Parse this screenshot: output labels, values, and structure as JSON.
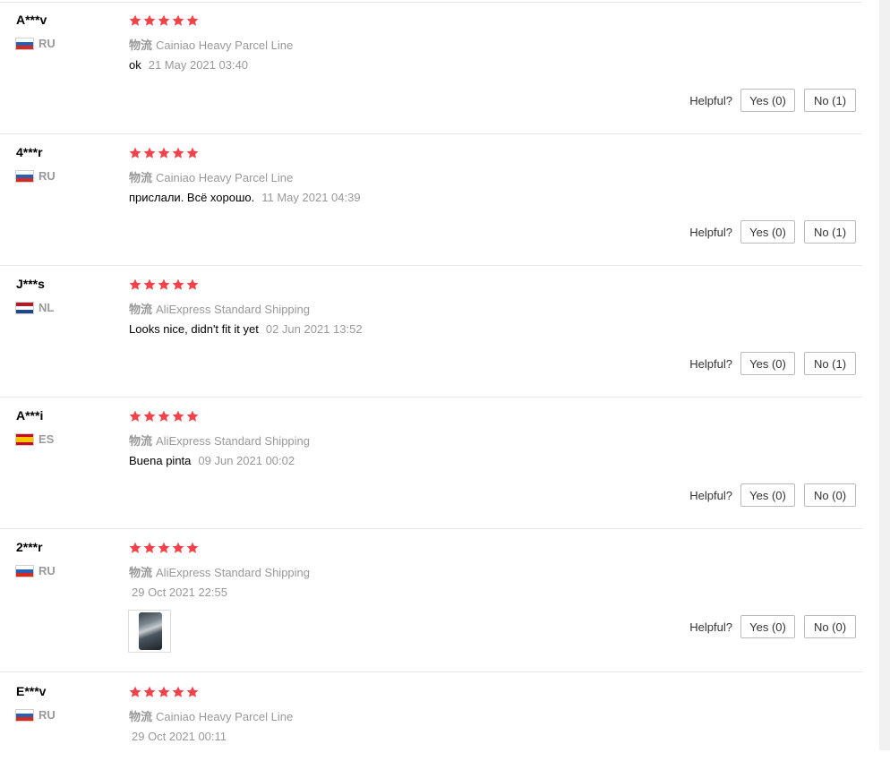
{
  "colors": {
    "star": "#f4424b",
    "muted_text": "#999999",
    "border": "#e8e8e8"
  },
  "helpful_label": "Helpful?",
  "reviews": [
    {
      "user": "A***v",
      "country": "RU",
      "flag_colors": [
        "#ffffff",
        "#2b5fb3",
        "#d52b1e"
      ],
      "stars": 5,
      "logistics_label": "物流",
      "logistics": "Cainiao Heavy Parcel Line",
      "text": "ok",
      "date": "21 May 2021 03:40",
      "yes": "Yes (0)",
      "no": "No (1)"
    },
    {
      "user": "4***r",
      "country": "RU",
      "flag_colors": [
        "#ffffff",
        "#2b5fb3",
        "#d52b1e"
      ],
      "stars": 5,
      "logistics_label": "物流",
      "logistics": "Cainiao Heavy Parcel Line",
      "text": "прислали. Всё хорошо.",
      "date": "11 May 2021 04:39",
      "yes": "Yes (0)",
      "no": "No (1)"
    },
    {
      "user": "J***s",
      "country": "NL",
      "flag_colors": [
        "#ae1c28",
        "#ffffff",
        "#21468b"
      ],
      "stars": 5,
      "logistics_label": "物流",
      "logistics": "AliExpress Standard Shipping",
      "text": "Looks nice, didn't fit it yet",
      "date": "02 Jun 2021 13:52",
      "yes": "Yes (0)",
      "no": "No (1)"
    },
    {
      "user": "A***i",
      "country": "ES",
      "flag_colors": [
        "#c60b1e",
        "#ffc400",
        "#c60b1e"
      ],
      "stars": 5,
      "logistics_label": "物流",
      "logistics": "AliExpress Standard Shipping",
      "text": "Buena pinta",
      "date": "09 Jun 2021 00:02",
      "yes": "Yes (0)",
      "no": "No (0)"
    },
    {
      "user": "2***r",
      "country": "RU",
      "flag_colors": [
        "#ffffff",
        "#2b5fb3",
        "#d52b1e"
      ],
      "stars": 5,
      "logistics_label": "物流",
      "logistics": "AliExpress Standard Shipping",
      "text": "",
      "date": "29 Oct 2021 22:55",
      "has_image": true,
      "yes": "Yes (0)",
      "no": "No (0)"
    },
    {
      "user": "E***v",
      "country": "RU",
      "flag_colors": [
        "#ffffff",
        "#2b5fb3",
        "#d52b1e"
      ],
      "stars": 5,
      "logistics_label": "物流",
      "logistics": "Cainiao Heavy Parcel Line",
      "text": "",
      "date": "29 Oct 2021 00:11"
    }
  ]
}
